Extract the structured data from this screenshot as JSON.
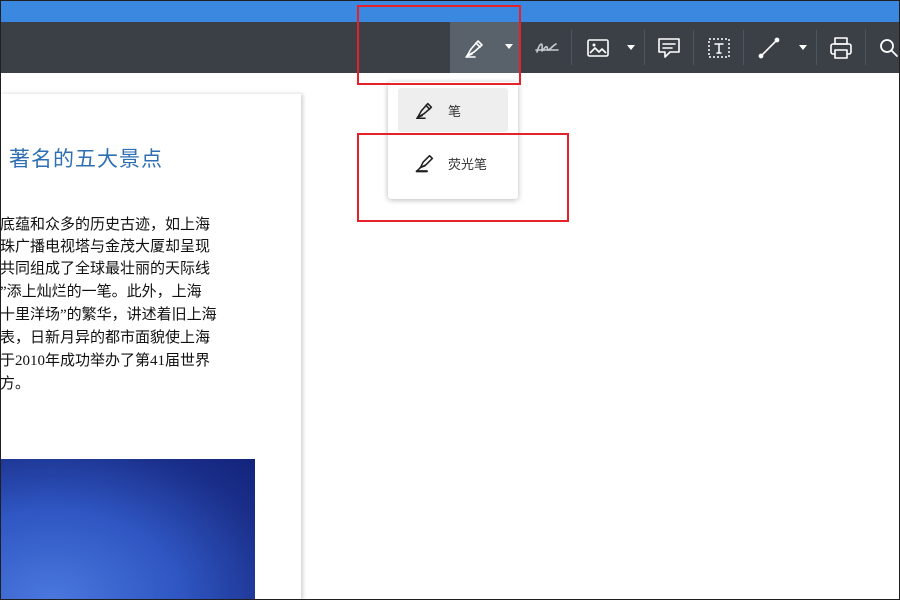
{
  "toolbar": {
    "tools": [
      {
        "name": "pen",
        "icon": "pen-icon",
        "active": true
      },
      {
        "name": "signature",
        "icon": "signature-icon"
      },
      {
        "name": "image",
        "icon": "image-icon"
      },
      {
        "name": "comment",
        "icon": "comment-icon"
      },
      {
        "name": "text-box",
        "icon": "text-box-icon"
      },
      {
        "name": "line",
        "icon": "line-icon"
      },
      {
        "name": "print",
        "icon": "print-icon"
      },
      {
        "name": "search",
        "icon": "search-icon"
      }
    ]
  },
  "pen_menu": {
    "items": [
      {
        "label": "笔",
        "icon": "pen-icon",
        "selected": true
      },
      {
        "label": "荧光笔",
        "icon": "highlighter-icon",
        "selected": false
      }
    ]
  },
  "document": {
    "title": "著名的五大景点",
    "paragraph": [
      "底蕴和众多的历史古迹，如上海",
      "珠广播电视塔与金茂大厦却呈现",
      "共同组成了全球最壮丽的天际线",
      "”添上灿烂的一笔。此外，上海",
      "十里洋场”的繁华，讲述着旧上海",
      "表，日新月异的都市面貌使上海",
      "于2010年成功举办了第41届世界",
      "方。"
    ]
  },
  "colors": {
    "title_bar": "#3b88e1",
    "toolbar": "#3a4046",
    "active_tool": "#59616a",
    "title_text": "#2e6fb3",
    "annotation_red": "#e5212a"
  }
}
